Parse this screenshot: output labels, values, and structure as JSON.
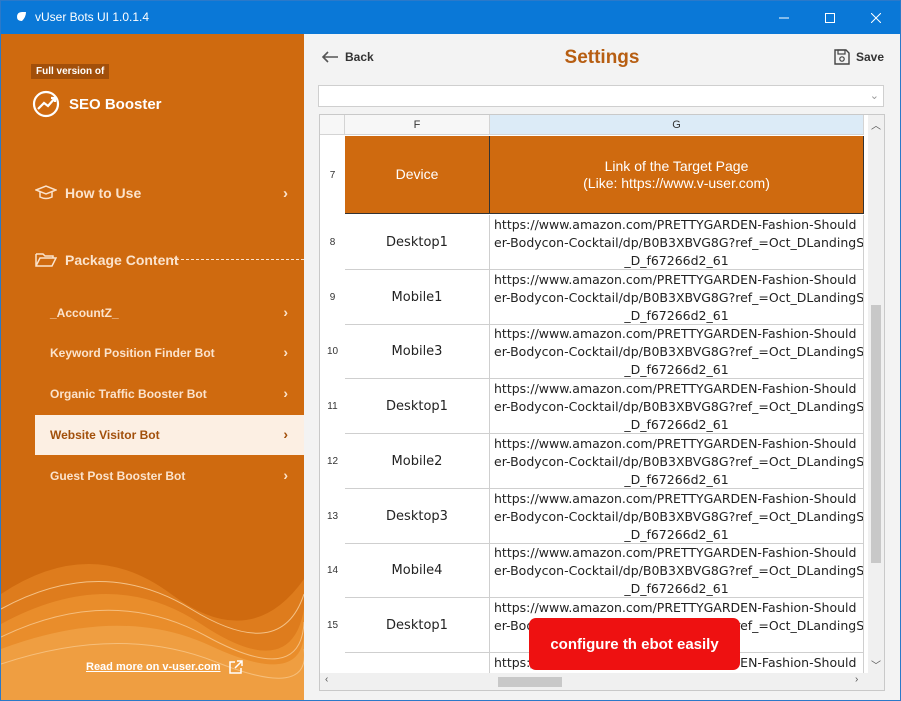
{
  "window": {
    "title": "vUser Bots UI 1.0.1.4",
    "controls": [
      "minimize",
      "maximize",
      "close"
    ]
  },
  "sidebar": {
    "badge": "Full version of",
    "brand": "SEO Booster",
    "how_to_use": "How to Use",
    "package_content": "Package Content",
    "items": [
      {
        "label": "_AccountZ_",
        "active": false
      },
      {
        "label": "Keyword Position Finder Bot",
        "active": false
      },
      {
        "label": "Organic Traffic Booster Bot",
        "active": false
      },
      {
        "label": "Website Visitor Bot",
        "active": true
      },
      {
        "label": "Guest Post Booster Bot",
        "active": false
      }
    ],
    "read_more": "Read more on v-user.com"
  },
  "header": {
    "back": "Back",
    "title": "Settings",
    "save": "Save"
  },
  "combo": {
    "value": ""
  },
  "sheet": {
    "columns": [
      "F",
      "G"
    ],
    "header_row": {
      "row": "7",
      "device": "Device",
      "link_line1": "Link of the Target Page",
      "link_line2": "(Like: https://www.v-user.com)"
    },
    "rows": [
      {
        "row": "8",
        "device": "Desktop1",
        "l1": "https://www.amazon.com/PRETTYGARDEN-Fashion-Should",
        "l2": "er-Bodycon-Cocktail/dp/B0B3XBVG8G?ref_=Oct_DLandingS",
        "l3": "_D_f67266d2_61"
      },
      {
        "row": "9",
        "device": "Mobile1",
        "l1": "https://www.amazon.com/PRETTYGARDEN-Fashion-Should",
        "l2": "er-Bodycon-Cocktail/dp/B0B3XBVG8G?ref_=Oct_DLandingS",
        "l3": "_D_f67266d2_61"
      },
      {
        "row": "10",
        "device": "Mobile3",
        "l1": "https://www.amazon.com/PRETTYGARDEN-Fashion-Should",
        "l2": "er-Bodycon-Cocktail/dp/B0B3XBVG8G?ref_=Oct_DLandingS",
        "l3": "_D_f67266d2_61"
      },
      {
        "row": "11",
        "device": "Desktop1",
        "l1": "https://www.amazon.com/PRETTYGARDEN-Fashion-Should",
        "l2": "er-Bodycon-Cocktail/dp/B0B3XBVG8G?ref_=Oct_DLandingS",
        "l3": "_D_f67266d2_61"
      },
      {
        "row": "12",
        "device": "Mobile2",
        "l1": "https://www.amazon.com/PRETTYGARDEN-Fashion-Should",
        "l2": "er-Bodycon-Cocktail/dp/B0B3XBVG8G?ref_=Oct_DLandingS",
        "l3": "_D_f67266d2_61"
      },
      {
        "row": "13",
        "device": "Desktop3",
        "l1": "https://www.amazon.com/PRETTYGARDEN-Fashion-Should",
        "l2": "er-Bodycon-Cocktail/dp/B0B3XBVG8G?ref_=Oct_DLandingS",
        "l3": "_D_f67266d2_61"
      },
      {
        "row": "14",
        "device": "Mobile4",
        "l1": "https://www.amazon.com/PRETTYGARDEN-Fashion-Should",
        "l2": "er-Bodycon-Cocktail/dp/B0B3XBVG8G?ref_=Oct_DLandingS",
        "l3": "_D_f67266d2_61"
      },
      {
        "row": "15",
        "device": "Desktop1",
        "l1": "https://www.amazon.com/PRETTYGARDEN-Fashion-Should",
        "l2": "er-Bodycon-Cocktail/dp/B0B3XBVG8G?ref_=Oct_DLandingS",
        "l3": "_D_f67266d2_61"
      },
      {
        "row": "",
        "device": "",
        "l1": "https://www.amazon.com/PRETTYGARDEN-Fashion-Should",
        "l2": "",
        "l3": ""
      }
    ]
  },
  "toast": {
    "text": "configure th ebot easily"
  },
  "colors": {
    "accent": "#cf6a0f",
    "title": "#b75e12",
    "titlebar": "#0a78d7",
    "toast": "#ee1111"
  }
}
